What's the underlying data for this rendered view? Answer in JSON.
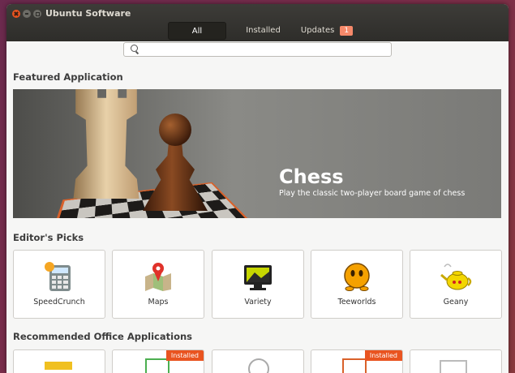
{
  "window": {
    "title": "Ubuntu Software"
  },
  "tabs": [
    {
      "label": "All"
    },
    {
      "label": "Installed"
    },
    {
      "label": "Updates",
      "badge": "1"
    }
  ],
  "search": {
    "placeholder": ""
  },
  "featured": {
    "section_title": "Featured Application",
    "title": "Chess",
    "subtitle": "Play the classic two-player board game of chess"
  },
  "editors_picks": {
    "section_title": "Editor's Picks",
    "items": [
      {
        "label": "SpeedCrunch",
        "icon": "calculator-icon"
      },
      {
        "label": "Maps",
        "icon": "map-icon"
      },
      {
        "label": "Variety",
        "icon": "wallpaper-icon"
      },
      {
        "label": "Teeworlds",
        "icon": "smiley-icon"
      },
      {
        "label": "Geany",
        "icon": "teapot-icon"
      }
    ]
  },
  "recommended": {
    "section_title": "Recommended Office Applications",
    "items": [
      {
        "installed_label": ""
      },
      {
        "installed_label": "Installed"
      },
      {
        "installed_label": ""
      },
      {
        "installed_label": "Installed"
      },
      {
        "installed_label": ""
      }
    ]
  },
  "colors": {
    "accent": "#e95420",
    "titlebar": "#2e2d2a",
    "badge": "#f6896a"
  }
}
